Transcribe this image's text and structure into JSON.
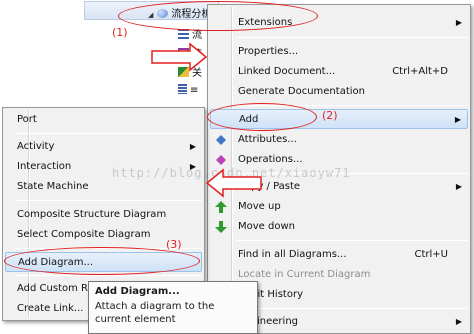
{
  "tree": {
    "root_label": "流程分析全图顾管理",
    "rows": [
      "流",
      "流",
      "关",
      "≡"
    ]
  },
  "callouts": {
    "one": "(1)",
    "two": "(2)",
    "three": "(3)"
  },
  "main_menu": {
    "extensions": "Extensions",
    "properties": "Properties...",
    "linked_document": "Linked Document...",
    "linked_document_shortcut": "Ctrl+Alt+D",
    "generate_documentation": "Generate Documentation",
    "add": "Add",
    "attributes": "Attributes...",
    "operations": "Operations...",
    "copy_paste": "Copy / Paste",
    "move_up": "Move up",
    "move_down": "Move down",
    "find_in_all_diagrams": "Find in all Diagrams...",
    "find_shortcut": "Ctrl+U",
    "locate_in_current_diagram": "Locate in Current Diagram",
    "audit_history": "Audit History",
    "engineering": "Engineering"
  },
  "sub_menu": {
    "port": "Port",
    "activity": "Activity",
    "interaction": "Interaction",
    "state_machine": "State Machine",
    "composite_structure_diagram": "Composite Structure Diagram",
    "select_composite_diagram": "Select Composite Diagram",
    "add_diagram": "Add Diagram...",
    "add_custom": "Add Custom Re",
    "create_link": "Create Link..."
  },
  "tooltip": {
    "title": "Add Diagram...",
    "body": "Attach a diagram to the current element"
  },
  "watermark": "http://blog.csdn.net/xiaoyw71",
  "colors": {
    "annotation_red": "#e21f1f",
    "highlight": "#cfe2f7"
  }
}
